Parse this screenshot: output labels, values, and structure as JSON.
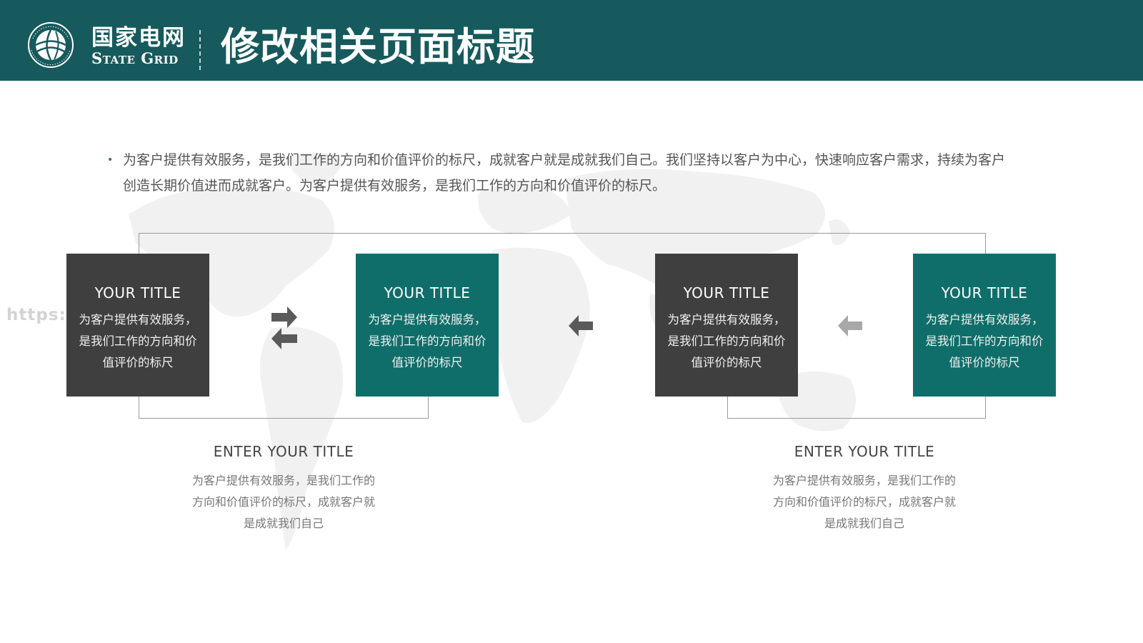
{
  "header": {
    "logo_cn": "国家电网",
    "logo_en": "State Grid",
    "title": "修改相关页面标题"
  },
  "intro": {
    "text": "为客户提供有效服务，是我们工作的方向和价值评价的标尺，成就客户就是成就我们自己。我们坚持以客户为中心，快速响应客户需求，持续为客户创造长期价值进而成就客户。为客户提供有效服务，是我们工作的方向和价值评价的标尺。"
  },
  "watermark": "https:/",
  "boxes": [
    {
      "title": "YOUR TITLE",
      "desc": "为客户提供有效服务，是我们工作的方向和价值评价的标尺",
      "style": "dark"
    },
    {
      "title": "YOUR TITLE",
      "desc": "为客户提供有效服务，是我们工作的方向和价值评价的标尺",
      "style": "teal"
    },
    {
      "title": "YOUR TITLE",
      "desc": "为客户提供有效服务，是我们工作的方向和价值评价的标尺",
      "style": "dark"
    },
    {
      "title": "YOUR TITLE",
      "desc": "为客户提供有效服务，是我们工作的方向和价值评价的标尺",
      "style": "teal"
    }
  ],
  "captions": [
    {
      "title": "ENTER YOUR TITLE",
      "text": "为客户提供有效服务，是我们工作的方向和价值评价的标尺，成就客户就是成就我们自己"
    },
    {
      "title": "ENTER YOUR TITLE",
      "text": "为客户提供有效服务，是我们工作的方向和价值评价的标尺，成就客户就是成就我们自己"
    }
  ],
  "icons": {
    "logo": "globe-logo-icon",
    "exchange": "exchange-arrows-icon",
    "left_dark": "arrow-left-icon",
    "left_light": "arrow-left-icon"
  },
  "colors": {
    "header": "#165a5d",
    "teal": "#0f6e6a",
    "dark": "#3f3f3f",
    "arrow_dark": "#5a5a5a",
    "arrow_light": "#a8a8a8"
  }
}
